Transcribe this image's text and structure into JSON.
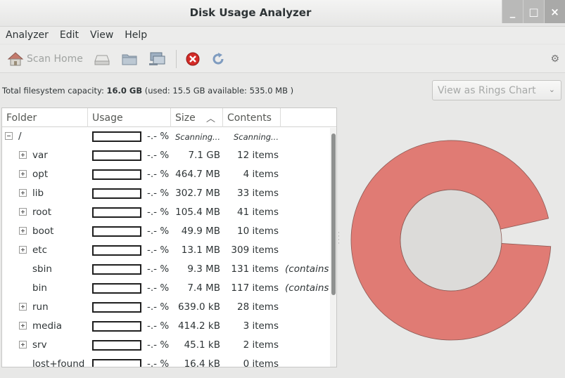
{
  "window": {
    "title": "Disk Usage Analyzer",
    "buttons": [
      "_",
      "□",
      "×"
    ]
  },
  "menu": [
    "Analyzer",
    "Edit",
    "View",
    "Help"
  ],
  "toolbar": {
    "scan_home": "Scan Home"
  },
  "capacity": {
    "prefix": "Total filesystem capacity:",
    "total": "16.0 GB",
    "detail": "(used: 15.5 GB available: 535.0 MB )"
  },
  "view_select": {
    "value": "View as Rings Chart"
  },
  "columns": {
    "folder": "Folder",
    "usage": "Usage",
    "size": "Size",
    "contents": "Contents"
  },
  "rows": [
    {
      "name": "/",
      "expander": "minus",
      "pct": "-.- %",
      "size": "Scanning...",
      "contents": "Scanning...",
      "scanning": true
    },
    {
      "name": "var",
      "expander": "plus",
      "pct": "-.- %",
      "size": "7.1 GB",
      "contents": "12 items"
    },
    {
      "name": "opt",
      "expander": "plus",
      "pct": "-.- %",
      "size": "464.7 MB",
      "contents": "4 items"
    },
    {
      "name": "lib",
      "expander": "plus",
      "pct": "-.- %",
      "size": "302.7 MB",
      "contents": "33 items"
    },
    {
      "name": "root",
      "expander": "plus",
      "pct": "-.- %",
      "size": "105.4 MB",
      "contents": "41 items"
    },
    {
      "name": "boot",
      "expander": "plus",
      "pct": "-.- %",
      "size": "49.9 MB",
      "contents": "10 items"
    },
    {
      "name": "etc",
      "expander": "plus",
      "pct": "-.- %",
      "size": "13.1 MB",
      "contents": "309 items"
    },
    {
      "name": "sbin",
      "expander": "none",
      "pct": "-.- %",
      "size": "9.3 MB",
      "contents": "131 items",
      "note": "(contains"
    },
    {
      "name": "bin",
      "expander": "none",
      "pct": "-.- %",
      "size": "7.4 MB",
      "contents": "117 items",
      "note": "(contains"
    },
    {
      "name": "run",
      "expander": "plus",
      "pct": "-.- %",
      "size": "639.0 kB",
      "contents": "28 items"
    },
    {
      "name": "media",
      "expander": "plus",
      "pct": "-.- %",
      "size": "414.2 kB",
      "contents": "3 items"
    },
    {
      "name": "srv",
      "expander": "plus",
      "pct": "-.- %",
      "size": "45.1 kB",
      "contents": "2 items"
    },
    {
      "name": "lost+found",
      "expander": "none",
      "pct": "-.- %",
      "size": "16.4 kB",
      "contents": "0 items"
    }
  ],
  "ring": {
    "color": "#e07b74",
    "inner_color": "#dcdbd9",
    "gap_fraction": 0.045
  }
}
